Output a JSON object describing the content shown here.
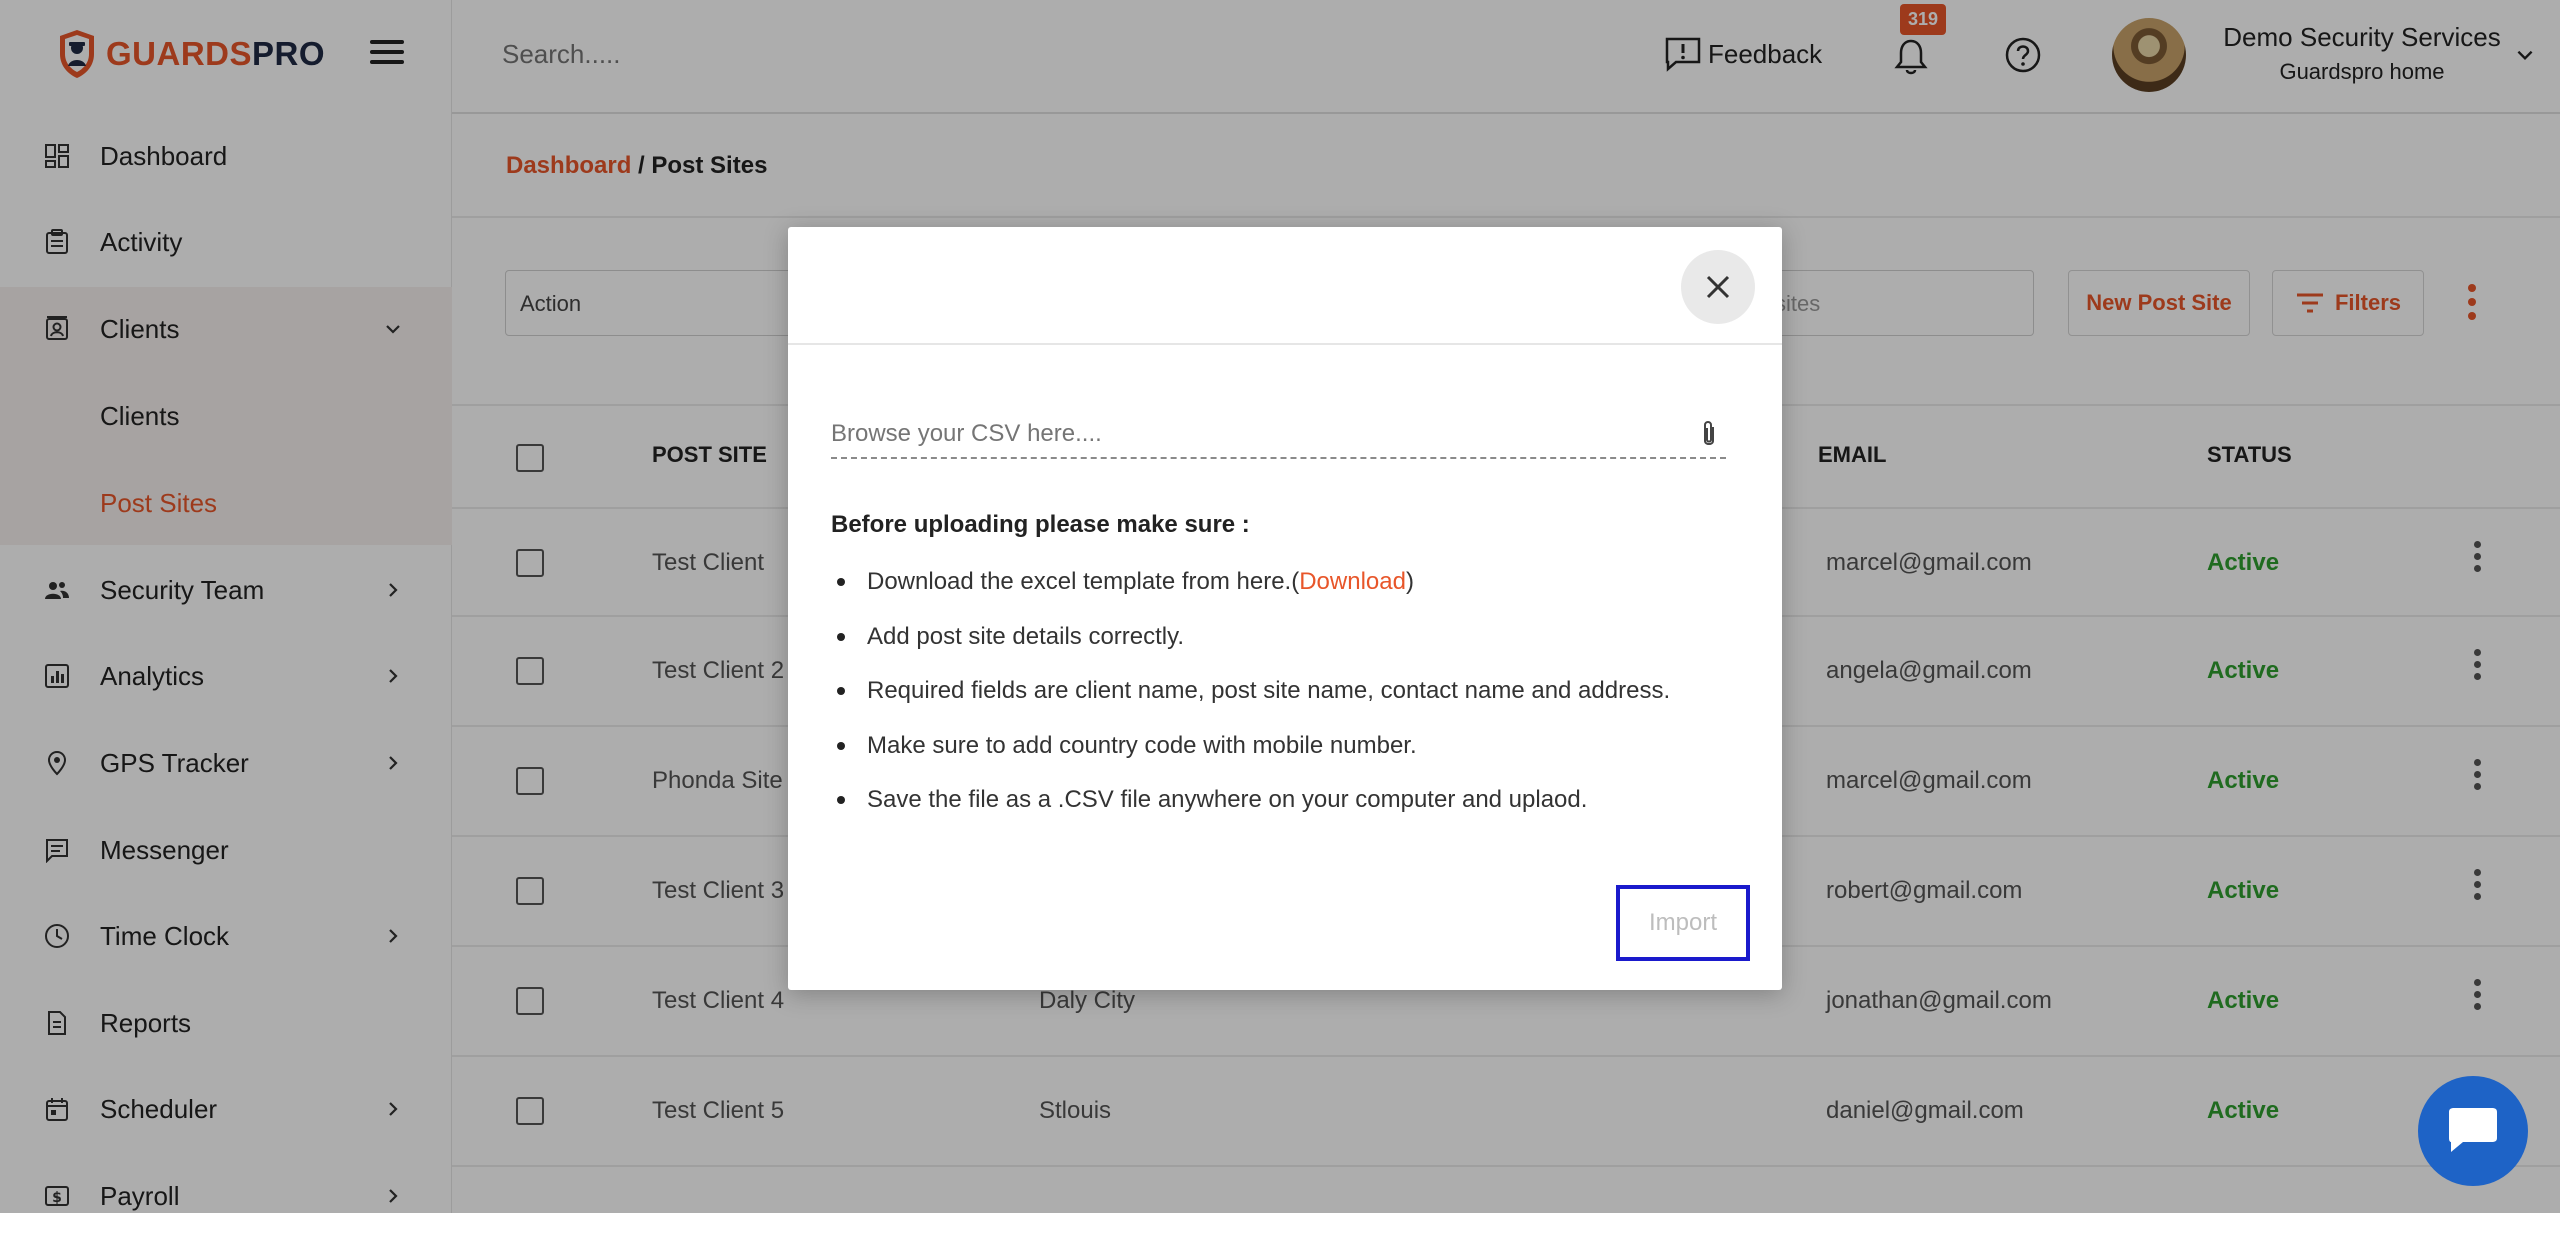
{
  "brand": {
    "part1": "GUARDS",
    "part2": "PRO"
  },
  "colors": {
    "accent": "#e8562a",
    "status_active": "#2e9e2e",
    "chat": "#1e63c6",
    "focus_outline": "#1a1acc"
  },
  "sidebar": {
    "items": [
      {
        "label": "Dashboard",
        "icon": "dashboard-icon"
      },
      {
        "label": "Activity",
        "icon": "clipboard-icon"
      },
      {
        "label": "Clients",
        "icon": "contact-card-icon"
      },
      {
        "label": "Security Team",
        "icon": "team-icon"
      },
      {
        "label": "Analytics",
        "icon": "bar-chart-icon"
      },
      {
        "label": "GPS Tracker",
        "icon": "location-pin-icon"
      },
      {
        "label": "Messenger",
        "icon": "message-icon"
      },
      {
        "label": "Time Clock",
        "icon": "clock-icon"
      },
      {
        "label": "Reports",
        "icon": "document-icon"
      },
      {
        "label": "Scheduler",
        "icon": "calendar-icon"
      },
      {
        "label": "Payroll",
        "icon": "payroll-icon"
      }
    ],
    "sub_items": [
      "Clients",
      "Post Sites"
    ]
  },
  "header": {
    "search_placeholder": "Search.....",
    "feedback": "Feedback",
    "notifications": "319",
    "org_name": "Demo Security Services",
    "org_sub": "Guardspro home"
  },
  "main": {
    "breadcrumb": {
      "root": "Dashboard",
      "sep": " / ",
      "current": "Post Sites"
    },
    "action_label": "Action",
    "search_posts": "sites",
    "new_post_site": "New Post Site",
    "filters": "Filters",
    "columns": {
      "post_site": "POST SITE",
      "email": "EMAIL",
      "status": "STATUS"
    },
    "rows": [
      {
        "name": "Test Client",
        "city": "",
        "email": "marcel@gmail.com",
        "status": "Active"
      },
      {
        "name": "Test Client 2",
        "city": "",
        "email": "angela@gmail.com",
        "status": "Active"
      },
      {
        "name": "Phonda Site",
        "city": "",
        "email": "marcel@gmail.com",
        "status": "Active"
      },
      {
        "name": "Test Client 3",
        "city": "",
        "email": "robert@gmail.com",
        "status": "Active"
      },
      {
        "name": "Test Client 4",
        "city": "Daly City",
        "email": "jonathan@gmail.com",
        "status": "Active"
      },
      {
        "name": "Test Client 5",
        "city": "Stlouis",
        "email": "daniel@gmail.com",
        "status": "Active"
      }
    ]
  },
  "modal": {
    "csv_placeholder": "Browse your CSV here....",
    "before_heading": "Before uploading please make sure :",
    "rules": {
      "r1_pre": "Download the excel template from here.(",
      "r1_link": "Download",
      "r1_post": ")",
      "r2": "Add post site details correctly.",
      "r3": "Required fields are client name, post site name, contact name and address.",
      "r4": "Make sure to add country code with mobile number.",
      "r5": "Save the file as a .CSV file anywhere on your computer and uplaod."
    },
    "import_label": "Import"
  }
}
